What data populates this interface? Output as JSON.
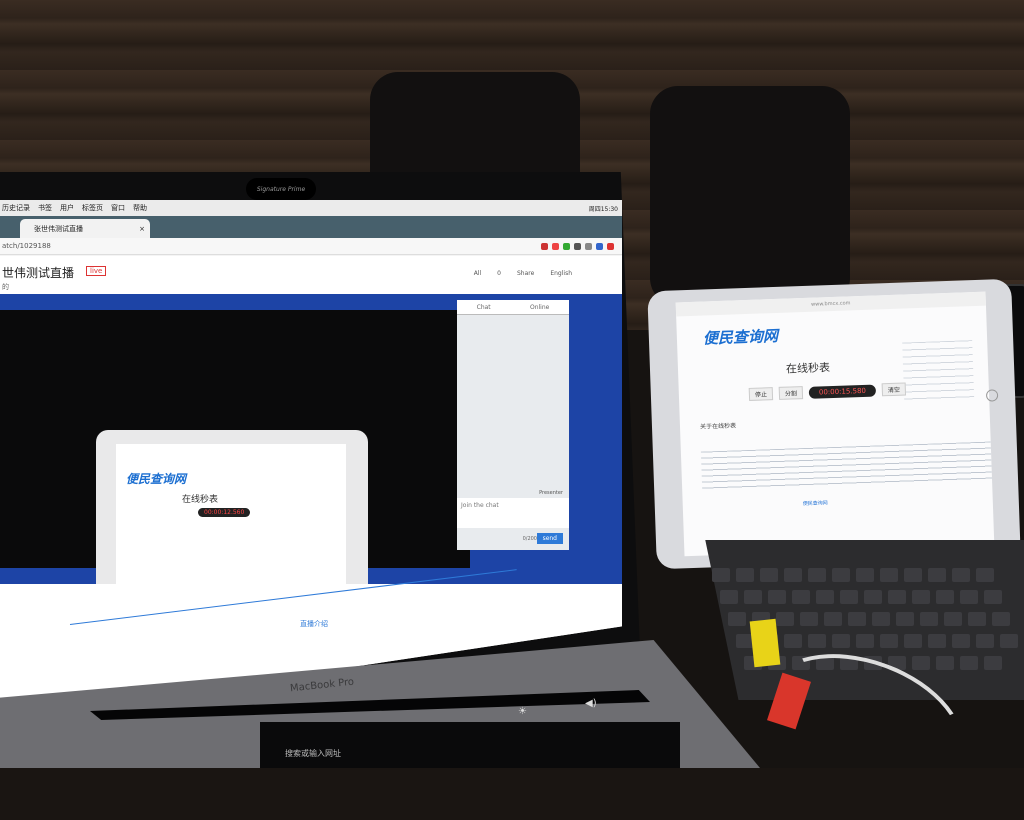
{
  "laptop": {
    "menubar": {
      "items": [
        "历史记录",
        "书签",
        "用户",
        "标签页",
        "窗口",
        "帮助"
      ],
      "status": "周四15:30"
    },
    "browser": {
      "tab_title": "张世伟测试直播",
      "url": "atch/1029188"
    },
    "page": {
      "title": "世伟测试直播",
      "live_badge": "live",
      "subtitle": "的",
      "actions": [
        "All",
        "0",
        "Share",
        "English"
      ]
    },
    "chat": {
      "tabs": [
        "Chat",
        "Online"
      ],
      "presenter": "Presenter",
      "input_placeholder": "Join the chat",
      "count": "0/200",
      "send_label": "send"
    },
    "video_tablet": {
      "logo": "便民查询网",
      "stopwatch_title": "在线秒表",
      "timer": "00:00:12.560"
    },
    "intro_link": "直播介绍",
    "camera_label": "Signature Prime",
    "brand": "MacBook Pro",
    "keyboard_address_hint": "搜索或输入网址"
  },
  "ipad": {
    "url": "www.bmcx.com",
    "logo": "便民查询网",
    "title": "在线秒表",
    "buttons": [
      "停止",
      "分割",
      "清空"
    ],
    "timer": "00:00:15.580",
    "section": "关于在线秒表",
    "footer": "便民查询网"
  },
  "colors": {
    "stage_blue": "#1d44a6",
    "link_blue": "#2e7ad8",
    "live_red": "#dd3333",
    "tag_yellow": "#e8d318",
    "tag_red": "#d9362b"
  }
}
